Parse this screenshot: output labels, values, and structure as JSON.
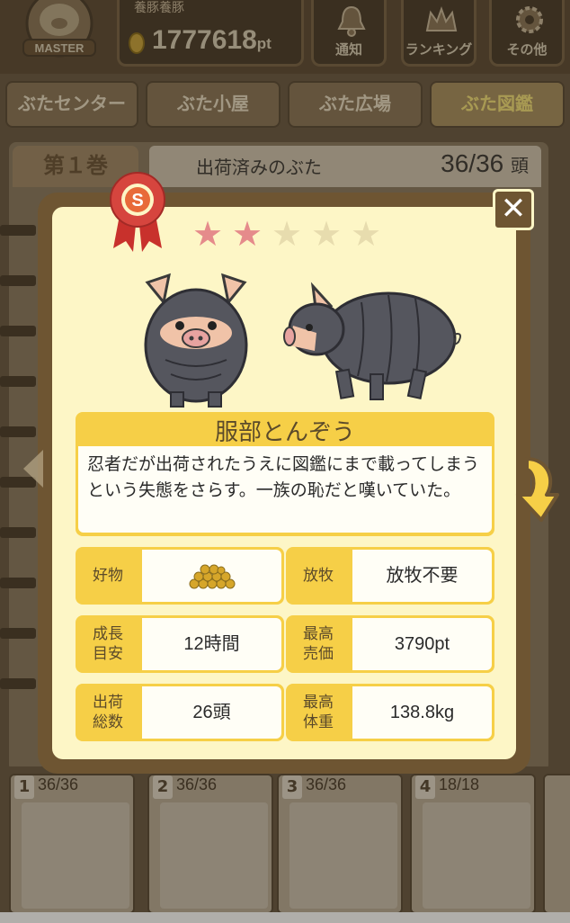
{
  "header": {
    "badge_label": "MASTER",
    "player_name": "養豚養豚",
    "points_value": "1777618",
    "points_unit": "pt",
    "buttons": [
      {
        "label": "通知",
        "icon": "bell-icon"
      },
      {
        "label": "ランキング",
        "icon": "crown-icon"
      },
      {
        "label": "その他",
        "icon": "gear-icon"
      }
    ]
  },
  "tabs": [
    {
      "label": "ぶたセンター"
    },
    {
      "label": "ぶた小屋"
    },
    {
      "label": "ぶた広場"
    },
    {
      "label": "ぶた図鑑",
      "active": true
    }
  ],
  "book": {
    "volume": "第１巻",
    "title": "出荷済みのぶた",
    "count": "36/36",
    "count_unit": "頭"
  },
  "mini_books": [
    {
      "num": "1",
      "count": "36/36"
    },
    {
      "num": "2",
      "count": "36/36"
    },
    {
      "num": "3",
      "count": "36/36"
    },
    {
      "num": "4",
      "count": "18/18"
    }
  ],
  "modal": {
    "rank": "S",
    "stars_filled": 2,
    "stars_total": 5,
    "colors": {
      "star_filled": "#e58b8b",
      "star_empty": "#e7dcae",
      "panel": "#f6cf47",
      "frame": "#6e5532"
    },
    "name": "服部とんぞう",
    "description": "忍者だが出荷されたうえに図鑑にまで載ってしまうという失態をさらす。一族の恥だと嘆いていた。",
    "stats": {
      "favorite": {
        "label": "好物",
        "icon": "food-pellets-icon"
      },
      "grazing": {
        "label": "放牧",
        "value": "放牧不要"
      },
      "growth": {
        "label_line1": "成長",
        "label_line2": "目安",
        "value": "12時間"
      },
      "max_price": {
        "label_line1": "最高",
        "label_line2": "売価",
        "value": "3790pt"
      },
      "shipped": {
        "label_line1": "出荷",
        "label_line2": "総数",
        "value": "26頭"
      },
      "max_weight": {
        "label_line1": "最高",
        "label_line2": "体重",
        "value": "138.8kg"
      }
    }
  }
}
